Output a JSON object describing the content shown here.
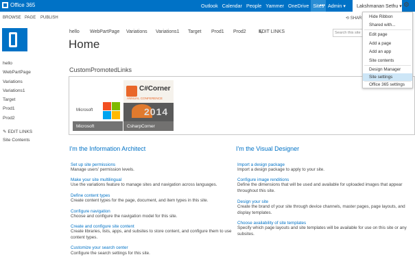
{
  "suitebar": {
    "brand": "Office 365",
    "nav": [
      "Outlook",
      "Calendar",
      "People",
      "Yammer",
      "OneDrive",
      "Sites"
    ],
    "dots": "•••",
    "admin": "Admin ▾",
    "user": "Lakshmanan Sethu ▾",
    "colors": {
      "bar": "#0072c6",
      "active": "#2a8dd4"
    }
  },
  "ribbon": {
    "tabs": [
      "BROWSE",
      "PAGE",
      "PUBLISH"
    ],
    "share": "SHAR"
  },
  "topnav": {
    "items": [
      "hello",
      "WebPartPage",
      "Variations",
      "Variations1",
      "Target",
      "Prod1",
      "Prod2"
    ],
    "edit_links": "EDIT LINKS"
  },
  "search": {
    "placeholder": "Search this site"
  },
  "page": {
    "title": "Home"
  },
  "quicklaunch": {
    "items": [
      "hello",
      "WebPartPage",
      "Variations",
      "Variations1",
      "Target",
      "Prod1",
      "Prod2"
    ],
    "edit_links": "EDIT LINKS",
    "site_contents": "Site Contents"
  },
  "promoted": {
    "title": "CustomPromotedLinks",
    "tiles": [
      {
        "label": "Microsoft",
        "logo_text": "Microsoft"
      },
      {
        "label": "CsharpCorner",
        "brand": "C#Corner",
        "subtitle": "ANNUAL CONFERENCE",
        "year": "2014"
      }
    ]
  },
  "architect": {
    "title": "I'm the Information Architect",
    "items": [
      {
        "head": "Set up site permissions",
        "desc": "Manage users' permission levels."
      },
      {
        "head": "Make your site multilingual",
        "desc": "Use the variations feature to manage sites and navigation across languages."
      },
      {
        "head": "Define content types",
        "desc": "Create content types for the page, document, and item types in this site."
      },
      {
        "head": "Configure navigation",
        "desc": "Choose and configure the navigation model for this site."
      },
      {
        "head": "Create and configure site content",
        "desc": "Create libraries, lists, apps, and subsites to store content, and configure them to use content types."
      },
      {
        "head": "Customize your search center",
        "desc": "Configure the search settings for this site."
      }
    ]
  },
  "designer": {
    "title": "I'm the Visual Designer",
    "items": [
      {
        "head": "Import a design package",
        "desc": "Import a design package to apply to your site."
      },
      {
        "head": "Configure image renditions",
        "desc": "Define the dimensions that will be used and available for uploaded images that appear throughout this site."
      },
      {
        "head": "Design your site",
        "desc": "Create the brand of your site through device channels, master pages, page layouts, and display templates."
      },
      {
        "head": "Choose availability of site templates",
        "desc": "Specify which page layouts and site templates will be available for use on this site or any subsites."
      }
    ]
  },
  "menu": {
    "items": [
      "Hide Ribbon",
      "Shared with...",
      "Edit page",
      "Add a page",
      "Add an app",
      "Site contents",
      "Design Manager",
      "Site settings",
      "Office 365 settings"
    ],
    "highlighted": "Site settings"
  }
}
